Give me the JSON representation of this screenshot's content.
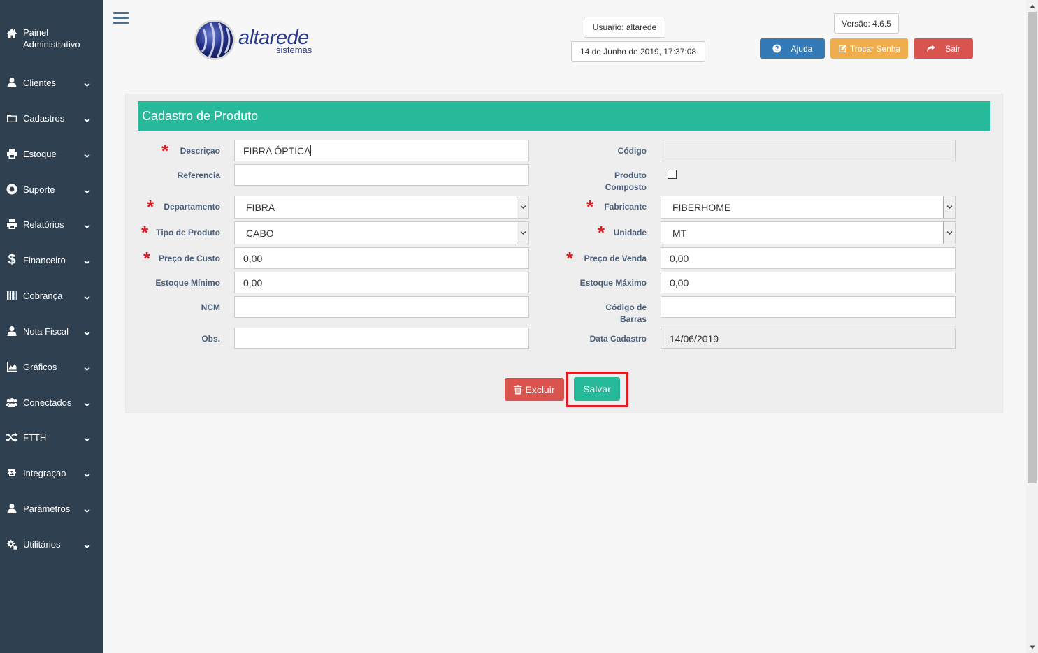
{
  "sidebar": {
    "items": [
      {
        "label": "Painel Administrativo",
        "icon": "home-icon"
      },
      {
        "label": "Clientes",
        "icon": "user-icon"
      },
      {
        "label": "Cadastros",
        "icon": "folder-icon"
      },
      {
        "label": "Estoque",
        "icon": "print-icon"
      },
      {
        "label": "Suporte",
        "icon": "lifebuoy-icon"
      },
      {
        "label": "Relatórios",
        "icon": "print-icon"
      },
      {
        "label": "Financeiro",
        "icon": "dollar-icon"
      },
      {
        "label": "Cobrança",
        "icon": "barcode-icon"
      },
      {
        "label": "Nota Fiscal",
        "icon": "user-icon"
      },
      {
        "label": "Gráficos",
        "icon": "area-chart-icon"
      },
      {
        "label": "Conectados",
        "icon": "users-icon"
      },
      {
        "label": "FTTH",
        "icon": "random-icon"
      },
      {
        "label": "Integraçao",
        "icon": "retweet-icon"
      },
      {
        "label": "Parâmetros",
        "icon": "user-icon"
      },
      {
        "label": "Utilitários",
        "icon": "cogs-icon"
      }
    ],
    "painel_line1": "Painel",
    "painel_line2": "Administrativo"
  },
  "header": {
    "logo_word": "altarede",
    "logo_sub": "sistemas",
    "user": "Usuário: altarede",
    "datetime": "14 de Junho de 2019, 17:37:08",
    "version": "Versão: 4.6.5",
    "btn_ajuda": "Ajuda",
    "btn_senha": "Trocar Senha",
    "btn_sair": "Sair"
  },
  "colors": {
    "sidebar_bg": "#2f4050",
    "panel_head": "#26b99a",
    "ajuda": "#337ab7",
    "senha": "#f0ad4e",
    "sair": "#d9534f",
    "required": "#e01b24"
  },
  "form": {
    "title": "Cadastro de Produto",
    "descricao_label": "Descriçao",
    "descricao_value": "FIBRA ÓPTICA",
    "referencia_label": "Referencia",
    "referencia_value": "",
    "departamento_label": "Departamento",
    "departamento_value": "FIBRA",
    "tipo_label": "Tipo de Produto",
    "tipo_value": "CABO",
    "custo_label": "Preço de Custo",
    "custo_value": "0,00",
    "est_min_label": "Estoque Mínimo",
    "est_min_value": "0,00",
    "ncm_label": "NCM",
    "ncm_value": "",
    "obs_label": "Obs.",
    "obs_value": "",
    "codigo_label": "Código",
    "codigo_value": "",
    "composto_label_1": "Produto",
    "composto_label_2": "Composto",
    "composto_checked": false,
    "fabricante_label": "Fabricante",
    "fabricante_value": "FIBERHOME",
    "unidade_label": "Unidade",
    "unidade_value": "MT",
    "venda_label": "Preço de Venda",
    "venda_value": "0,00",
    "est_max_label": "Estoque Máximo",
    "est_max_value": "0,00",
    "barras_label_1": "Código de",
    "barras_label_2": "Barras",
    "barras_value": "",
    "data_label": "Data Cadastro",
    "data_value": "14/06/2019",
    "btn_excluir": "Excluir",
    "btn_salvar": "Salvar"
  }
}
